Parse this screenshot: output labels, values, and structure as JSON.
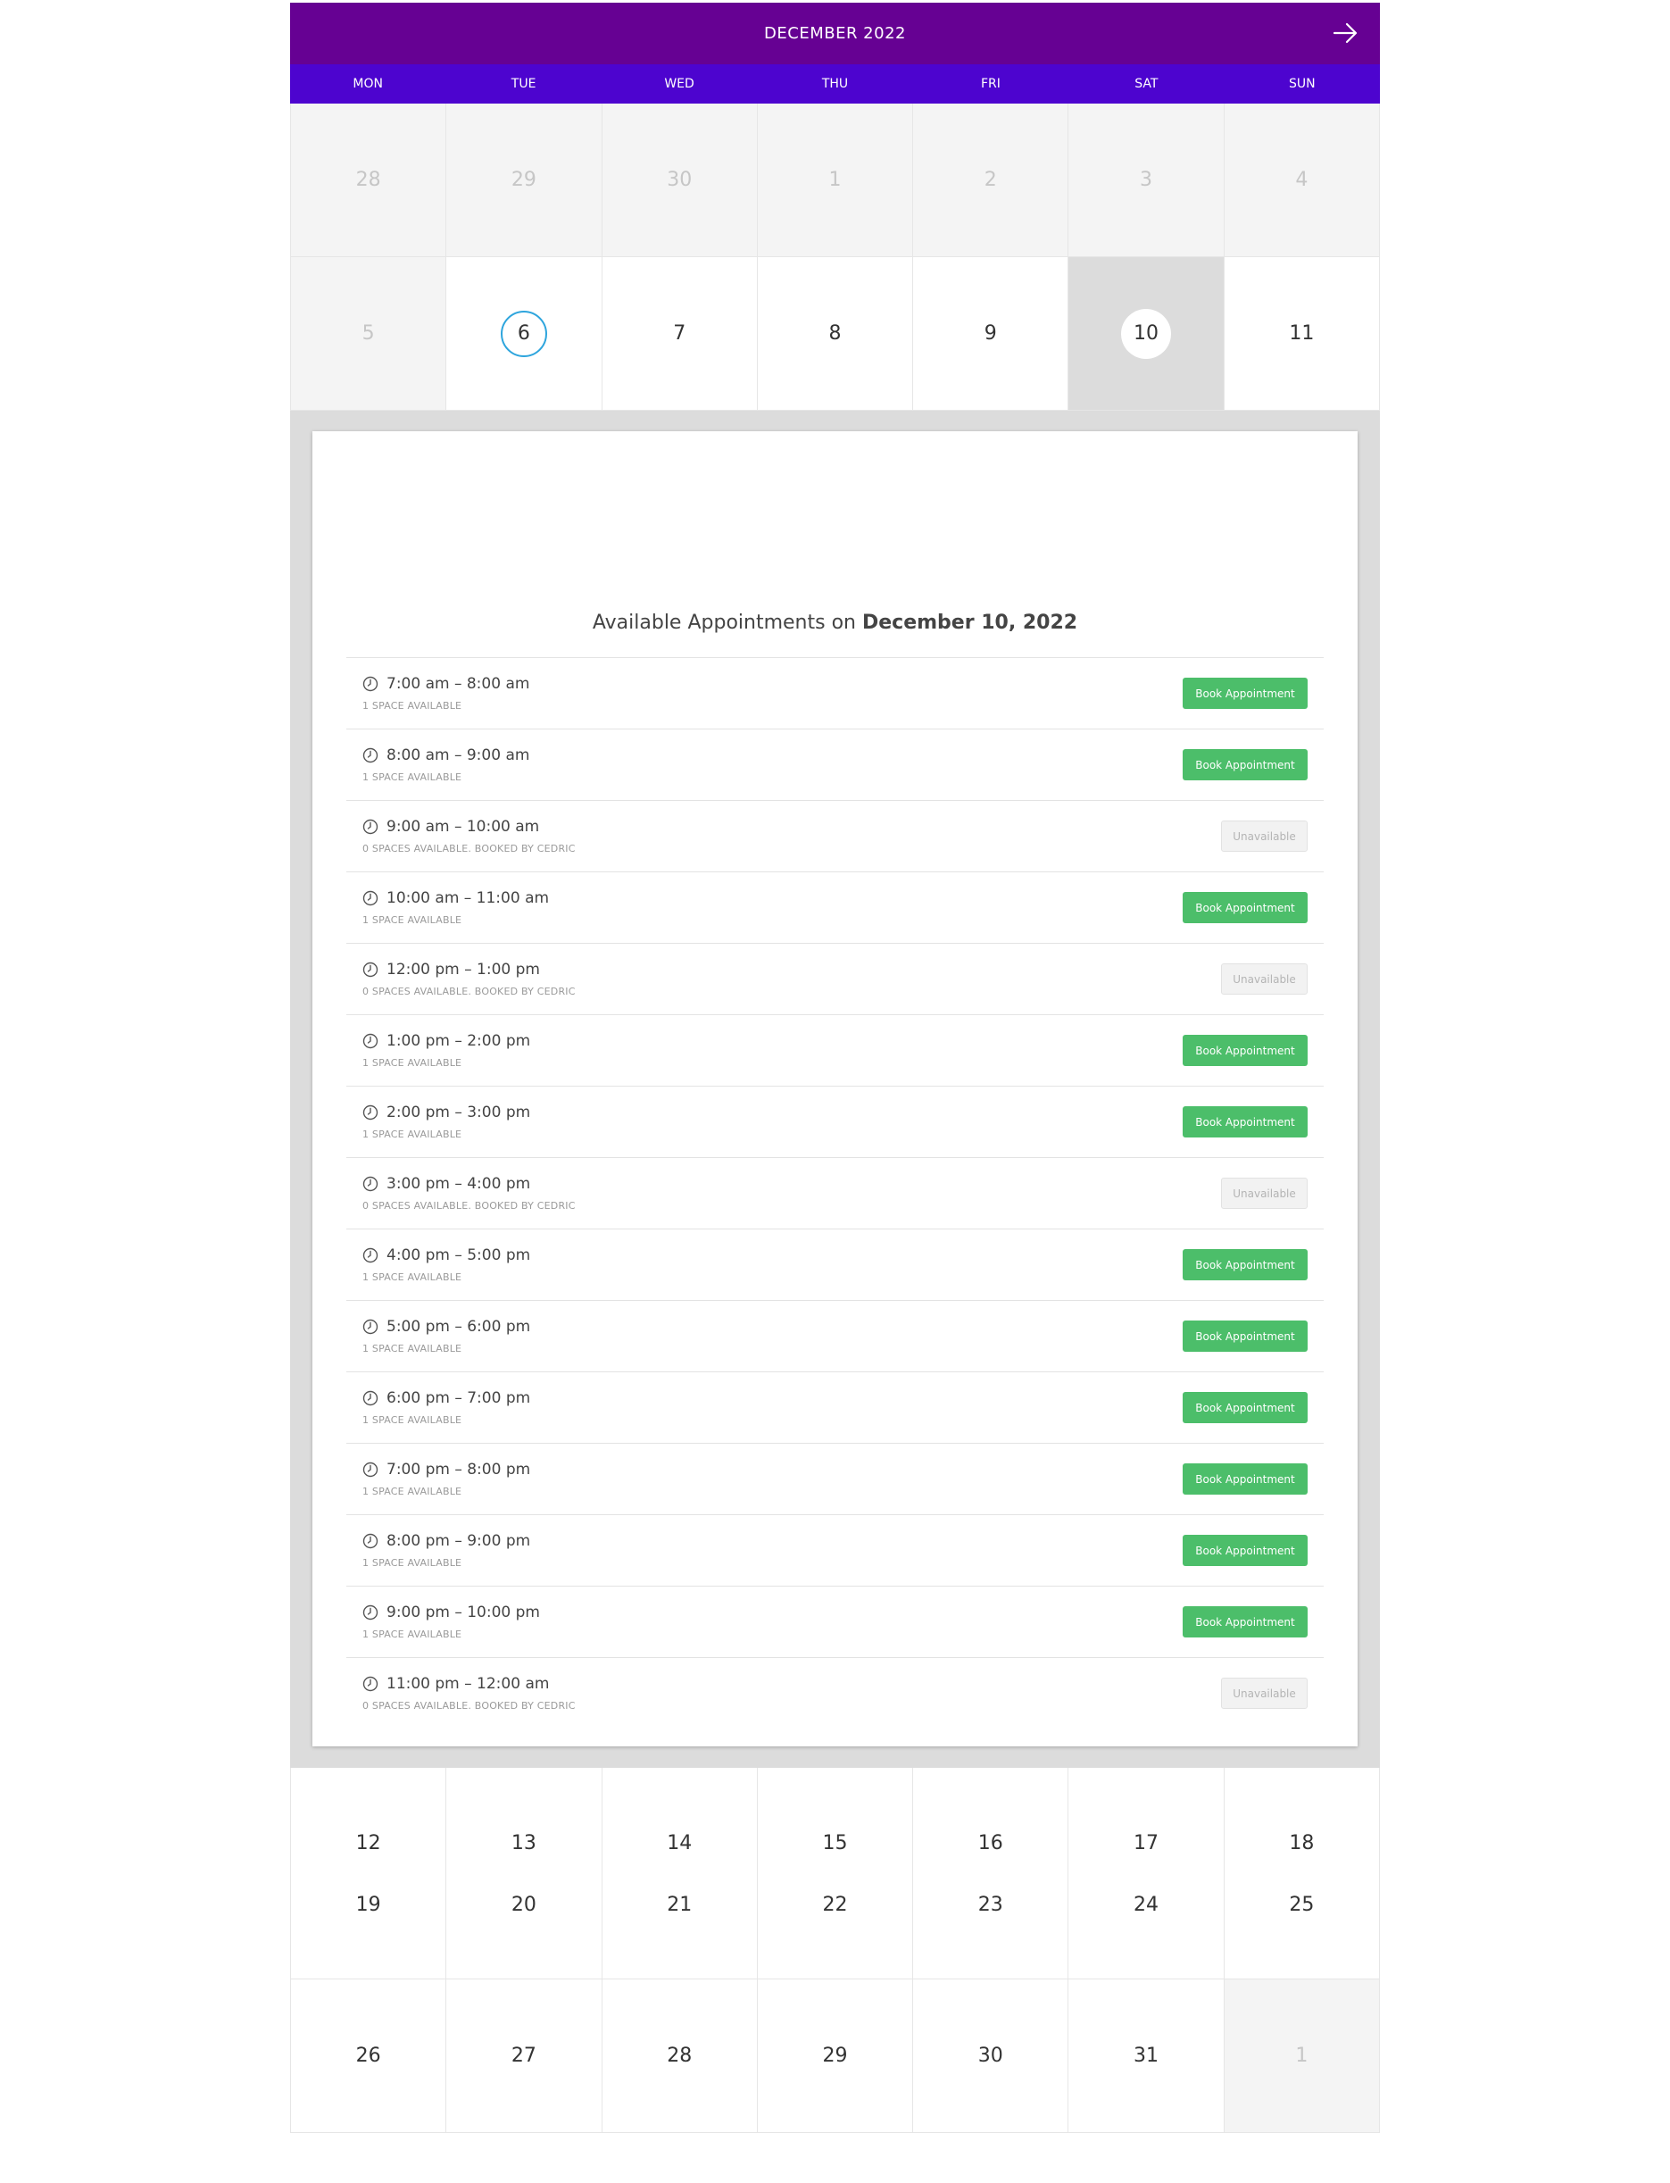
{
  "calendar": {
    "month_label": "DECEMBER 2022",
    "weekdays": [
      "MON",
      "TUE",
      "WED",
      "THU",
      "FRI",
      "SAT",
      "SUN"
    ],
    "week1": [
      "28",
      "29",
      "30",
      "1",
      "2",
      "3",
      "4"
    ],
    "week2": [
      "5",
      "6",
      "7",
      "8",
      "9",
      "10",
      "11"
    ],
    "week3": [
      "12",
      "13",
      "14",
      "15",
      "16",
      "17",
      "18"
    ],
    "week4": [
      "19",
      "20",
      "21",
      "22",
      "23",
      "24",
      "25"
    ],
    "week5": [
      "26",
      "27",
      "28",
      "29",
      "30",
      "31",
      "1"
    ]
  },
  "panel": {
    "title_prefix": "Available Appointments on",
    "title_date": "December 10, 2022"
  },
  "slots": [
    {
      "time": "7:00 am – 8:00 am",
      "meta": "1 SPACE AVAILABLE",
      "action": "Book Appointment",
      "available": true
    },
    {
      "time": "8:00 am – 9:00 am",
      "meta": "1 SPACE AVAILABLE",
      "action": "Book Appointment",
      "available": true
    },
    {
      "time": "9:00 am – 10:00 am",
      "meta": "0 SPACES AVAILABLE. BOOKED BY CEDRIC",
      "action": "Unavailable",
      "available": false
    },
    {
      "time": "10:00 am – 11:00 am",
      "meta": "1 SPACE AVAILABLE",
      "action": "Book Appointment",
      "available": true
    },
    {
      "time": "12:00 pm – 1:00 pm",
      "meta": "0 SPACES AVAILABLE. BOOKED BY CEDRIC",
      "action": "Unavailable",
      "available": false
    },
    {
      "time": "1:00 pm – 2:00 pm",
      "meta": "1 SPACE AVAILABLE",
      "action": "Book Appointment",
      "available": true
    },
    {
      "time": "2:00 pm – 3:00 pm",
      "meta": "1 SPACE AVAILABLE",
      "action": "Book Appointment",
      "available": true
    },
    {
      "time": "3:00 pm – 4:00 pm",
      "meta": "0 SPACES AVAILABLE. BOOKED BY CEDRIC",
      "action": "Unavailable",
      "available": false
    },
    {
      "time": "4:00 pm – 5:00 pm",
      "meta": "1 SPACE AVAILABLE",
      "action": "Book Appointment",
      "available": true
    },
    {
      "time": "5:00 pm – 6:00 pm",
      "meta": "1 SPACE AVAILABLE",
      "action": "Book Appointment",
      "available": true
    },
    {
      "time": "6:00 pm – 7:00 pm",
      "meta": "1 SPACE AVAILABLE",
      "action": "Book Appointment",
      "available": true
    },
    {
      "time": "7:00 pm – 8:00 pm",
      "meta": "1 SPACE AVAILABLE",
      "action": "Book Appointment",
      "available": true
    },
    {
      "time": "8:00 pm – 9:00 pm",
      "meta": "1 SPACE AVAILABLE",
      "action": "Book Appointment",
      "available": true
    },
    {
      "time": "9:00 pm – 10:00 pm",
      "meta": "1 SPACE AVAILABLE",
      "action": "Book Appointment",
      "available": true
    },
    {
      "time": "11:00 pm – 12:00 am",
      "meta": "0 SPACES AVAILABLE. BOOKED BY CEDRIC",
      "action": "Unavailable",
      "available": false
    }
  ],
  "colors": {
    "header": "#660193",
    "weekday_bar": "#4d04cf",
    "book_button": "#4cbe6a",
    "today_ring": "#2ea5dd"
  },
  "icons": {
    "next": "arrow-right-icon",
    "slot": "clock-icon"
  }
}
